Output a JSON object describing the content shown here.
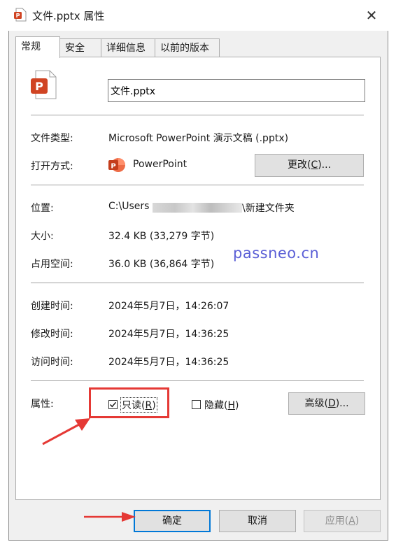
{
  "window": {
    "title": "文件.pptx 属性",
    "close_glyph": "✕"
  },
  "tabs": [
    {
      "label": "常规",
      "active": true
    },
    {
      "label": "安全",
      "active": false
    },
    {
      "label": "详细信息",
      "active": false
    },
    {
      "label": "以前的版本",
      "active": false
    }
  ],
  "general": {
    "filename": "文件.pptx",
    "file_type": {
      "label": "文件类型:",
      "value": "Microsoft PowerPoint 演示文稿 (.pptx)"
    },
    "opens_with": {
      "label": "打开方式:",
      "app": "PowerPoint",
      "change_button": "更改(C)...",
      "change_pre": "更改(",
      "change_key": "C",
      "change_post": ")..."
    },
    "location": {
      "label": "位置:",
      "prefix": "C:\\Users",
      "suffix": "\\新建文件夹"
    },
    "size": {
      "label": "大小:",
      "value": "32.4 KB (33,279 字节)"
    },
    "size_on_disk": {
      "label": "占用空间:",
      "value": "36.0 KB (36,864 字节)"
    },
    "created": {
      "label": "创建时间:",
      "value": "2024年5月7日，14:26:07"
    },
    "modified": {
      "label": "修改时间:",
      "value": "2024年5月7日，14:36:25"
    },
    "accessed": {
      "label": "访问时间:",
      "value": "2024年5月7日，14:36:25"
    },
    "attributes": {
      "label": "属性:",
      "readonly": {
        "pre": "只读(",
        "key": "R",
        "post": ")",
        "checked": true
      },
      "hidden": {
        "pre": "隐藏(",
        "key": "H",
        "post": ")",
        "checked": false
      },
      "advanced": {
        "pre": "高级(",
        "key": "D",
        "post": ")..."
      }
    }
  },
  "watermark": "passneo.cn",
  "footer": {
    "ok": "确定",
    "cancel": "取消",
    "apply_pre": "应用(",
    "apply_key": "A",
    "apply_post": ")"
  },
  "colors": {
    "highlight_box": "#e53935",
    "arrow": "#e53935",
    "watermark": "#5b5fd6",
    "ok_border": "#0078d7",
    "powerpoint": "#d04423"
  }
}
